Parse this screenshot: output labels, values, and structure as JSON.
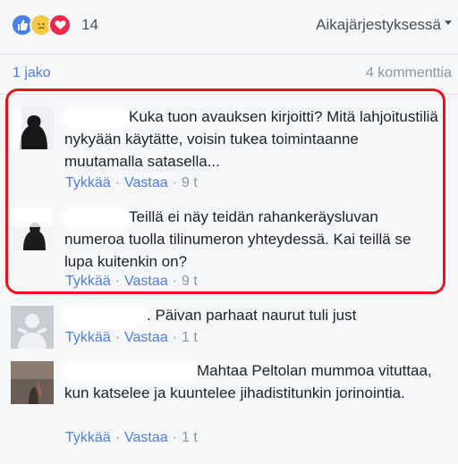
{
  "reactions": {
    "icons": [
      "like-icon",
      "sad-icon",
      "love-icon"
    ],
    "colors": {
      "like": "#4b7ee8",
      "sad": "#f7c948",
      "love": "#f0284a"
    },
    "count": "14"
  },
  "sort": {
    "label": "Aikajärjestyksessä"
  },
  "stats": {
    "shares": "1 jako",
    "comments": "4 kommenttia"
  },
  "comments": [
    {
      "text": "Kuka tuon avauksen kirjoitti? Mitä lahjoitustiliä nykyään käytätte, voisin tukea toimintaanne muutamalla satasella...",
      "like": "Tykkää",
      "reply": "Vastaa",
      "time": "9 t"
    },
    {
      "text": "Teillä ei näy teidän rahankeräysluvan numeroa tuolla tilinumeron yhteydessä. Kai teillä se lupa kuitenkin on?",
      "like": "Tykkää",
      "reply": "Vastaa",
      "time": "9 t"
    },
    {
      "text": ". Päivan parhaat naurut tuli just",
      "like": "Tykkää",
      "reply": "Vastaa",
      "time": "1 t"
    },
    {
      "text": "Mahtaa Peltolan mummoa vituttaa, kun katselee ja kuuntelee jihadistitunkin jorinointia.",
      "like": "Tykkää",
      "reply": "Vastaa",
      "time": "1 t"
    }
  ],
  "colors": {
    "link": "#4b7ee8",
    "highlight": "#e8141e",
    "muted": "#90949c"
  }
}
